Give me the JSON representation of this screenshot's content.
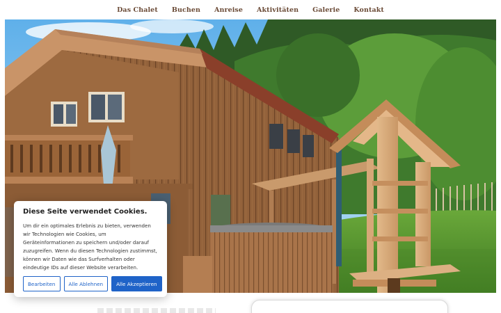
{
  "nav": {
    "items": [
      "Das Chalet",
      "Buchen",
      "Anreise",
      "Aktivitäten",
      "Galerie",
      "Kontakt"
    ]
  },
  "hero": {
    "image": "wooden chalet with hot tub and wooden play tower"
  },
  "cookie_banner": {
    "title": "Diese Seite verwendet Cookies.",
    "body": "Um dir ein optimales Erlebnis zu bieten, verwenden wir Technologien wie Cookies, um Geräteinformationen zu speichern und/oder darauf zuzugreifen. Wenn du diesen Technologien zustimmst, können wir Daten wie das Surfverhalten oder eindeutige IDs auf dieser Website verarbeiten.",
    "buttons": {
      "settings": "Bearbeiten",
      "reject": "Alle Ablehnen",
      "accept": "Alle Akzeptieren"
    }
  },
  "colors": {
    "nav_text": "#6a4a36",
    "accent": "#1f63c8"
  }
}
